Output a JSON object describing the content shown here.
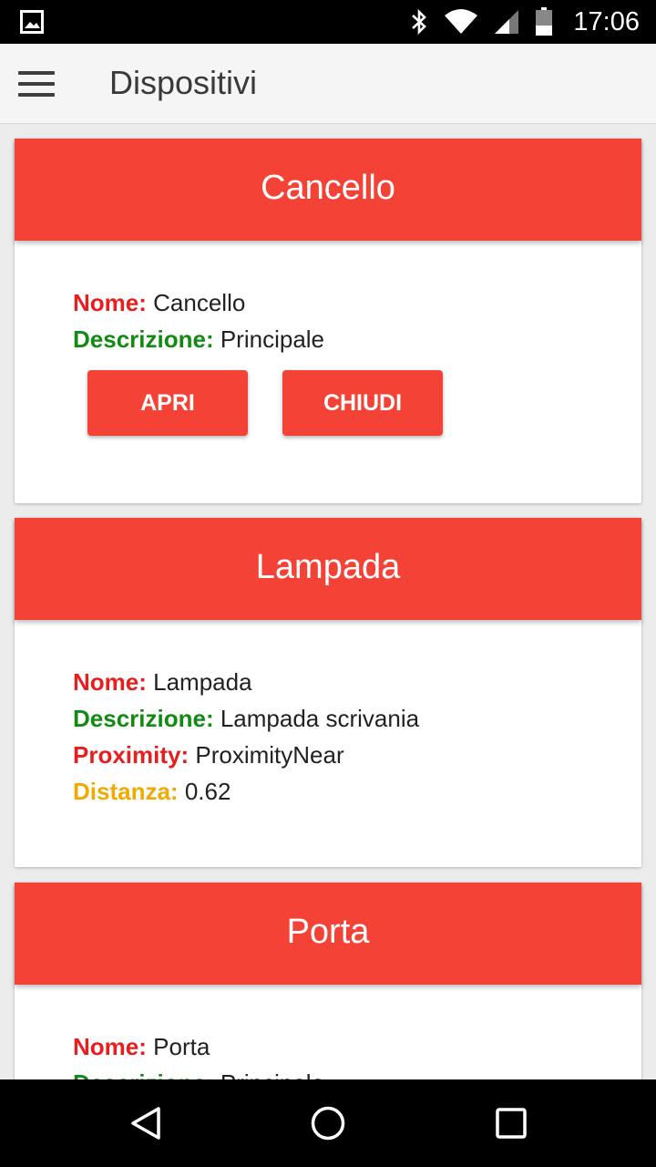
{
  "status_bar": {
    "time": "17:06",
    "icons": [
      "image-icon",
      "bluetooth-icon",
      "wifi-icon",
      "signal-icon",
      "battery-icon"
    ]
  },
  "app_bar": {
    "title": "Dispositivi",
    "menu_icon": "menu-icon"
  },
  "colors": {
    "accent": "#f44336",
    "label_red": "#e81e1e",
    "label_green": "#138a13",
    "label_orange": "#f2a900"
  },
  "cards": [
    {
      "title": "Cancello",
      "fields": [
        {
          "label": "Nome:",
          "value": "Cancello"
        },
        {
          "label": "Descrizione:",
          "value": "Principale"
        }
      ],
      "buttons": [
        "APRI",
        "CHIUDI"
      ]
    },
    {
      "title": "Lampada",
      "fields": [
        {
          "label": "Nome:",
          "value": "Lampada"
        },
        {
          "label": "Descrizione:",
          "value": "Lampada scrivania"
        },
        {
          "label": "Proximity:",
          "value": "ProximityNear"
        },
        {
          "label": "Distanza:",
          "value": "0.62"
        }
      ]
    },
    {
      "title": "Porta",
      "fields": [
        {
          "label": "Nome:",
          "value": "Porta"
        },
        {
          "label": "Descrizione:",
          "value": "Principale"
        }
      ]
    }
  ],
  "nav_bar": {
    "icons": [
      "back-icon",
      "home-icon",
      "recents-icon"
    ]
  }
}
